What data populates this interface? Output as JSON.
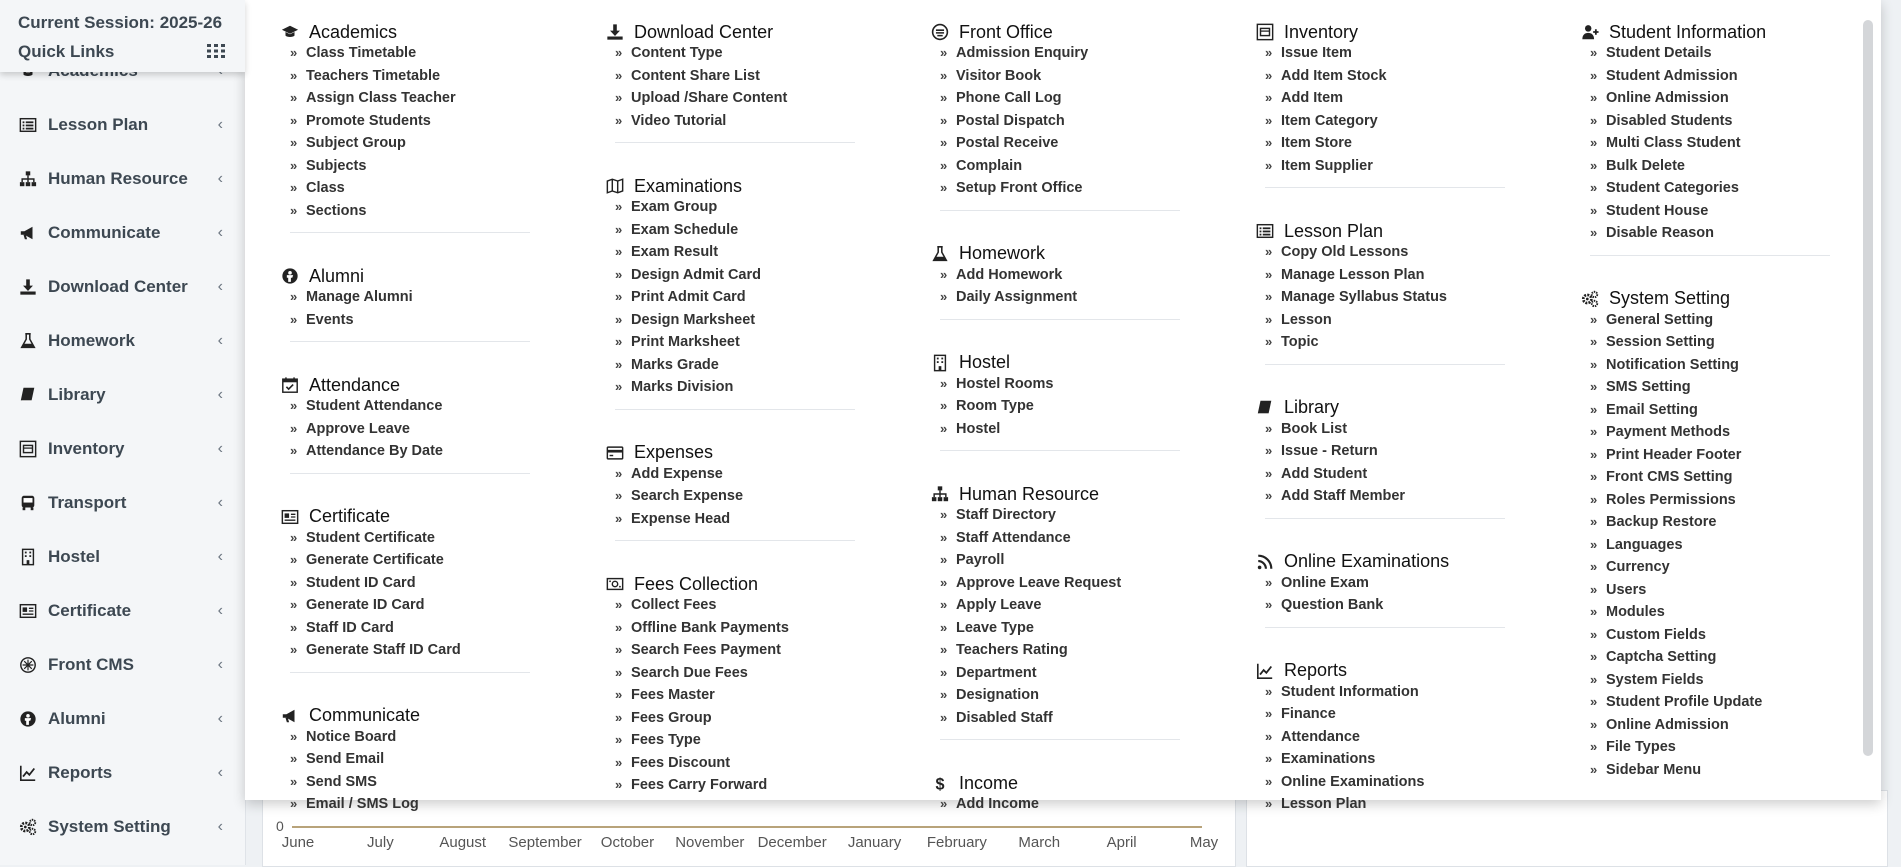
{
  "session": {
    "title": "Current Session: 2025-26",
    "quick_links": "Quick Links"
  },
  "sidebar": {
    "items": [
      {
        "label": "Academics",
        "icon": "graduation-cap-icon"
      },
      {
        "label": "Lesson Plan",
        "icon": "list-icon"
      },
      {
        "label": "Human Resource",
        "icon": "sitemap-icon"
      },
      {
        "label": "Communicate",
        "icon": "bullhorn-icon"
      },
      {
        "label": "Download Center",
        "icon": "download-icon"
      },
      {
        "label": "Homework",
        "icon": "flask-icon"
      },
      {
        "label": "Library",
        "icon": "book-icon"
      },
      {
        "label": "Inventory",
        "icon": "inventory-icon"
      },
      {
        "label": "Transport",
        "icon": "bus-icon"
      },
      {
        "label": "Hostel",
        "icon": "building-icon"
      },
      {
        "label": "Certificate",
        "icon": "certificate-icon"
      },
      {
        "label": "Front CMS",
        "icon": "cms-icon"
      },
      {
        "label": "Alumni",
        "icon": "alumni-icon"
      },
      {
        "label": "Reports",
        "icon": "line-chart-icon"
      },
      {
        "label": "System Setting",
        "icon": "gears-icon"
      }
    ],
    "chevron": "‹"
  },
  "chart": {
    "zero_label": "0",
    "months": [
      "June",
      "July",
      "August",
      "September",
      "October",
      "November",
      "December",
      "January",
      "February",
      "March",
      "April",
      "May"
    ]
  },
  "menu": {
    "columns": [
      [
        {
          "title": "Academics",
          "icon": "graduation-cap-icon",
          "links": [
            "Class Timetable",
            "Teachers Timetable",
            "Assign Class Teacher",
            "Promote Students",
            "Subject Group",
            "Subjects",
            "Class",
            "Sections"
          ]
        },
        {
          "title": "Alumni",
          "icon": "alumni-icon",
          "links": [
            "Manage Alumni",
            "Events"
          ]
        },
        {
          "title": "Attendance",
          "icon": "calendar-check-icon",
          "links": [
            "Student Attendance",
            "Approve Leave",
            "Attendance By Date"
          ]
        },
        {
          "title": "Certificate",
          "icon": "certificate-icon",
          "links": [
            "Student Certificate",
            "Generate Certificate",
            "Student ID Card",
            "Generate ID Card",
            "Staff ID Card",
            "Generate Staff ID Card"
          ]
        },
        {
          "title": "Communicate",
          "icon": "bullhorn-icon",
          "links": [
            "Notice Board",
            "Send Email",
            "Send SMS",
            "Email / SMS Log"
          ]
        }
      ],
      [
        {
          "title": "Download Center",
          "icon": "download-icon",
          "links": [
            "Content Type",
            "Content Share List",
            "Upload /Share Content",
            "Video Tutorial"
          ]
        },
        {
          "title": "Examinations",
          "icon": "map-icon",
          "links": [
            "Exam Group",
            "Exam Schedule",
            "Exam Result",
            "Design Admit Card",
            "Print Admit Card",
            "Design Marksheet",
            "Print Marksheet",
            "Marks Grade",
            "Marks Division"
          ]
        },
        {
          "title": "Expenses",
          "icon": "credit-card-icon",
          "links": [
            "Add Expense",
            "Search Expense",
            "Expense Head"
          ]
        },
        {
          "title": "Fees Collection",
          "icon": "money-icon",
          "links": [
            "Collect Fees",
            "Offline Bank Payments",
            "Search Fees Payment",
            "Search Due Fees",
            "Fees Master",
            "Fees Group",
            "Fees Type",
            "Fees Discount",
            "Fees Carry Forward"
          ]
        }
      ],
      [
        {
          "title": "Front Office",
          "icon": "front-office-icon",
          "links": [
            "Admission Enquiry",
            "Visitor Book",
            "Phone Call Log",
            "Postal Dispatch",
            "Postal Receive",
            "Complain",
            "Setup Front Office"
          ]
        },
        {
          "title": "Homework",
          "icon": "flask-icon",
          "links": [
            "Add Homework",
            "Daily Assignment"
          ]
        },
        {
          "title": "Hostel",
          "icon": "building-icon",
          "links": [
            "Hostel Rooms",
            "Room Type",
            "Hostel"
          ]
        },
        {
          "title": "Human Resource",
          "icon": "sitemap-icon",
          "links": [
            "Staff Directory",
            "Staff Attendance",
            "Payroll",
            "Approve Leave Request",
            "Apply Leave",
            "Leave Type",
            "Teachers Rating",
            "Department",
            "Designation",
            "Disabled Staff"
          ]
        },
        {
          "title": "Income",
          "icon": "dollar-icon",
          "links": [
            "Add Income"
          ]
        }
      ],
      [
        {
          "title": "Inventory",
          "icon": "inventory-icon",
          "links": [
            "Issue Item",
            "Add Item Stock",
            "Add Item",
            "Item Category",
            "Item Store",
            "Item Supplier"
          ]
        },
        {
          "title": "Lesson Plan",
          "icon": "list-icon",
          "links": [
            "Copy Old Lessons",
            "Manage Lesson Plan",
            "Manage Syllabus Status",
            "Lesson",
            "Topic"
          ]
        },
        {
          "title": "Library",
          "icon": "book-icon",
          "links": [
            "Book List",
            "Issue - Return",
            "Add Student",
            "Add Staff Member"
          ]
        },
        {
          "title": "Online Examinations",
          "icon": "rss-icon",
          "links": [
            "Online Exam",
            "Question Bank"
          ]
        },
        {
          "title": "Reports",
          "icon": "line-chart-icon",
          "links": [
            "Student Information",
            "Finance",
            "Attendance",
            "Examinations",
            "Online Examinations",
            "Lesson Plan"
          ]
        }
      ],
      [
        {
          "title": "Student Information",
          "icon": "user-plus-icon",
          "links": [
            "Student Details",
            "Student Admission",
            "Online Admission",
            "Disabled Students",
            "Multi Class Student",
            "Bulk Delete",
            "Student Categories",
            "Student House",
            "Disable Reason"
          ]
        },
        {
          "title": "System Setting",
          "icon": "gears-icon",
          "links": [
            "General Setting",
            "Session Setting",
            "Notification Setting",
            "SMS Setting",
            "Email Setting",
            "Payment Methods",
            "Print Header Footer",
            "Front CMS Setting",
            "Roles Permissions",
            "Backup Restore",
            "Languages",
            "Currency",
            "Users",
            "Modules",
            "Custom Fields",
            "Captcha Setting",
            "System Fields",
            "Student Profile Update",
            "Online Admission",
            "File Types",
            "Sidebar Menu"
          ]
        }
      ]
    ]
  }
}
